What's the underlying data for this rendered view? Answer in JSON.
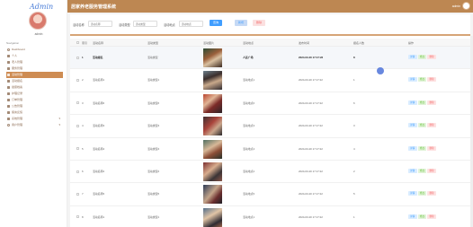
{
  "app": {
    "logo_text": "Admin",
    "system_title": "居家养老服务管理系统",
    "admin_label": "admin",
    "username": "admin",
    "accent": "#bd8752",
    "active_nav": "#ce8c53"
  },
  "sidebar": {
    "nav_title": "Navigation",
    "items": [
      {
        "label": "Dashboard",
        "icon": "dashboard-icon"
      },
      {
        "label": "个人",
        "icon": "person-icon"
      },
      {
        "label": "老人管理",
        "icon": "users-icon"
      },
      {
        "label": "服务管理",
        "icon": "service-icon"
      },
      {
        "label": "活动管理",
        "icon": "activity-icon",
        "active": true
      },
      {
        "label": "活动报名",
        "icon": "signup-icon"
      },
      {
        "label": "健康档案",
        "icon": "health-icon"
      },
      {
        "label": "护理记录",
        "icon": "care-icon"
      },
      {
        "label": "订单管理",
        "icon": "order-icon"
      },
      {
        "label": "公告管理",
        "icon": "notice-icon"
      },
      {
        "label": "留言反馈",
        "icon": "message-icon"
      },
      {
        "label": "系统管理",
        "icon": "settings-icon",
        "caret": true
      },
      {
        "label": "用户管理",
        "icon": "user-mgmt-icon",
        "caret": true
      }
    ]
  },
  "search": {
    "field1_label": "活动名称",
    "field1_placeholder": "活动名称",
    "field2_label": "活动类型",
    "field2_placeholder": "活动类型",
    "field3_label": "活动地点",
    "field3_placeholder": "活动地点",
    "search_button": "查询",
    "add_button": "新增",
    "delete_button": "删除"
  },
  "table": {
    "headers": [
      "索引",
      "活动名称",
      "活动类型",
      "活动图片",
      "活动地点",
      "发布时间",
      "报名人数",
      "操作"
    ],
    "ops": {
      "detail": "详情",
      "edit": "修改",
      "delete": "删除"
    },
    "rows": [
      {
        "index": "1",
        "name": "活动报名",
        "type": "活动类型",
        "place": "人民广场",
        "time": "2024-03-20 17:17:22",
        "count": "8"
      },
      {
        "index": "2",
        "name": "活动名称1",
        "type": "活动类型1",
        "place": "活动地点1",
        "time": "2024-03-20 17:17:22",
        "count": "1"
      },
      {
        "index": "3",
        "name": "活动名称6",
        "type": "活动类型6",
        "place": "活动地点6",
        "time": "2024-03-20 17:17:22",
        "count": "6"
      },
      {
        "index": "4",
        "name": "活动名称3",
        "type": "活动类型3",
        "place": "活动地点3",
        "time": "2024-03-20 17:17:22",
        "count": "3"
      },
      {
        "index": "5",
        "name": "活动名称4",
        "type": "活动类型4",
        "place": "活动地点4",
        "time": "2024-03-20 17:17:22",
        "count": "4"
      },
      {
        "index": "6",
        "name": "活动名称2",
        "type": "活动类型2",
        "place": "活动地点2",
        "time": "2024-03-20 17:17:22",
        "count": "2"
      },
      {
        "index": "7",
        "name": "活动名称5",
        "type": "活动类型5",
        "place": "活动地点5",
        "time": "2024-03-20 17:17:22",
        "count": "5"
      },
      {
        "index": "8",
        "name": "活动名称1",
        "type": "活动类型1",
        "place": "活动地点1",
        "time": "2024-03-20 17:17:22",
        "count": "1"
      }
    ]
  }
}
